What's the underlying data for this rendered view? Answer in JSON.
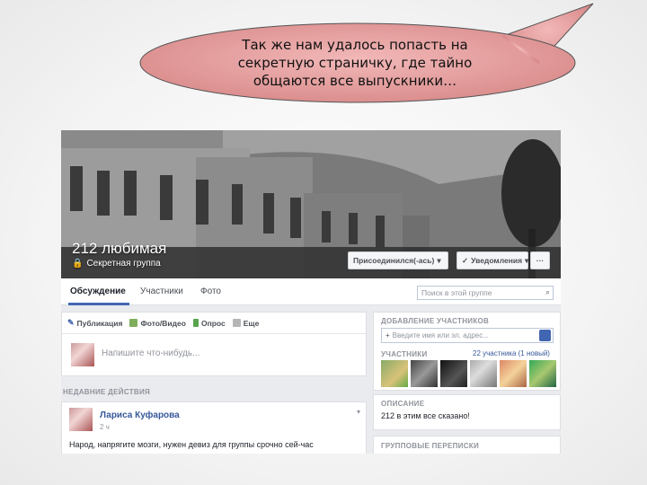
{
  "bubble": {
    "line1": "Так же нам удалось попасть на",
    "line2": "секретную страничку, где тайно",
    "line3": "общаются все выпускники…"
  },
  "group": {
    "name": "212 любимая",
    "type": "Секретная группа",
    "joined_label": "Присоединился(-ась)",
    "notifications_label": "Уведомления",
    "more_label": "···"
  },
  "tabs": [
    {
      "label": "Обсуждение"
    },
    {
      "label": "Участники"
    },
    {
      "label": "Фото"
    }
  ],
  "search": {
    "placeholder": "Поиск в этой группе"
  },
  "composer": {
    "publish_label": "Публикация",
    "photo_label": "Фото/Видео",
    "poll_label": "Опрос",
    "more_label": "Еще",
    "placeholder": "Напишите что-нибудь..."
  },
  "recent": {
    "section_title": "НЕДАВНИЕ ДЕЙСТВИЯ",
    "post": {
      "author": "Лариса Куфарова",
      "time": "2 ч",
      "text": "Народ, напрягите мозги, нужен девиз для группы срочно сей-час"
    }
  },
  "sidebar": {
    "add_members_title": "ДОБАВЛЕНИЕ УЧАСТНИКОВ",
    "add_placeholder": "Введите имя или эл. адрес...",
    "members_title": "УЧАСТНИКИ",
    "members_count": "22 участника (1 новый)",
    "description_title": "ОПИСАНИЕ",
    "description_text": "212 в этим все сказано!",
    "group_chats_title": "ГРУППОВЫЕ ПЕРЕПИСКИ"
  },
  "colors": {
    "fb_blue": "#4267b2",
    "link_blue": "#365899",
    "bubble_fill": "#e8a1a1"
  }
}
